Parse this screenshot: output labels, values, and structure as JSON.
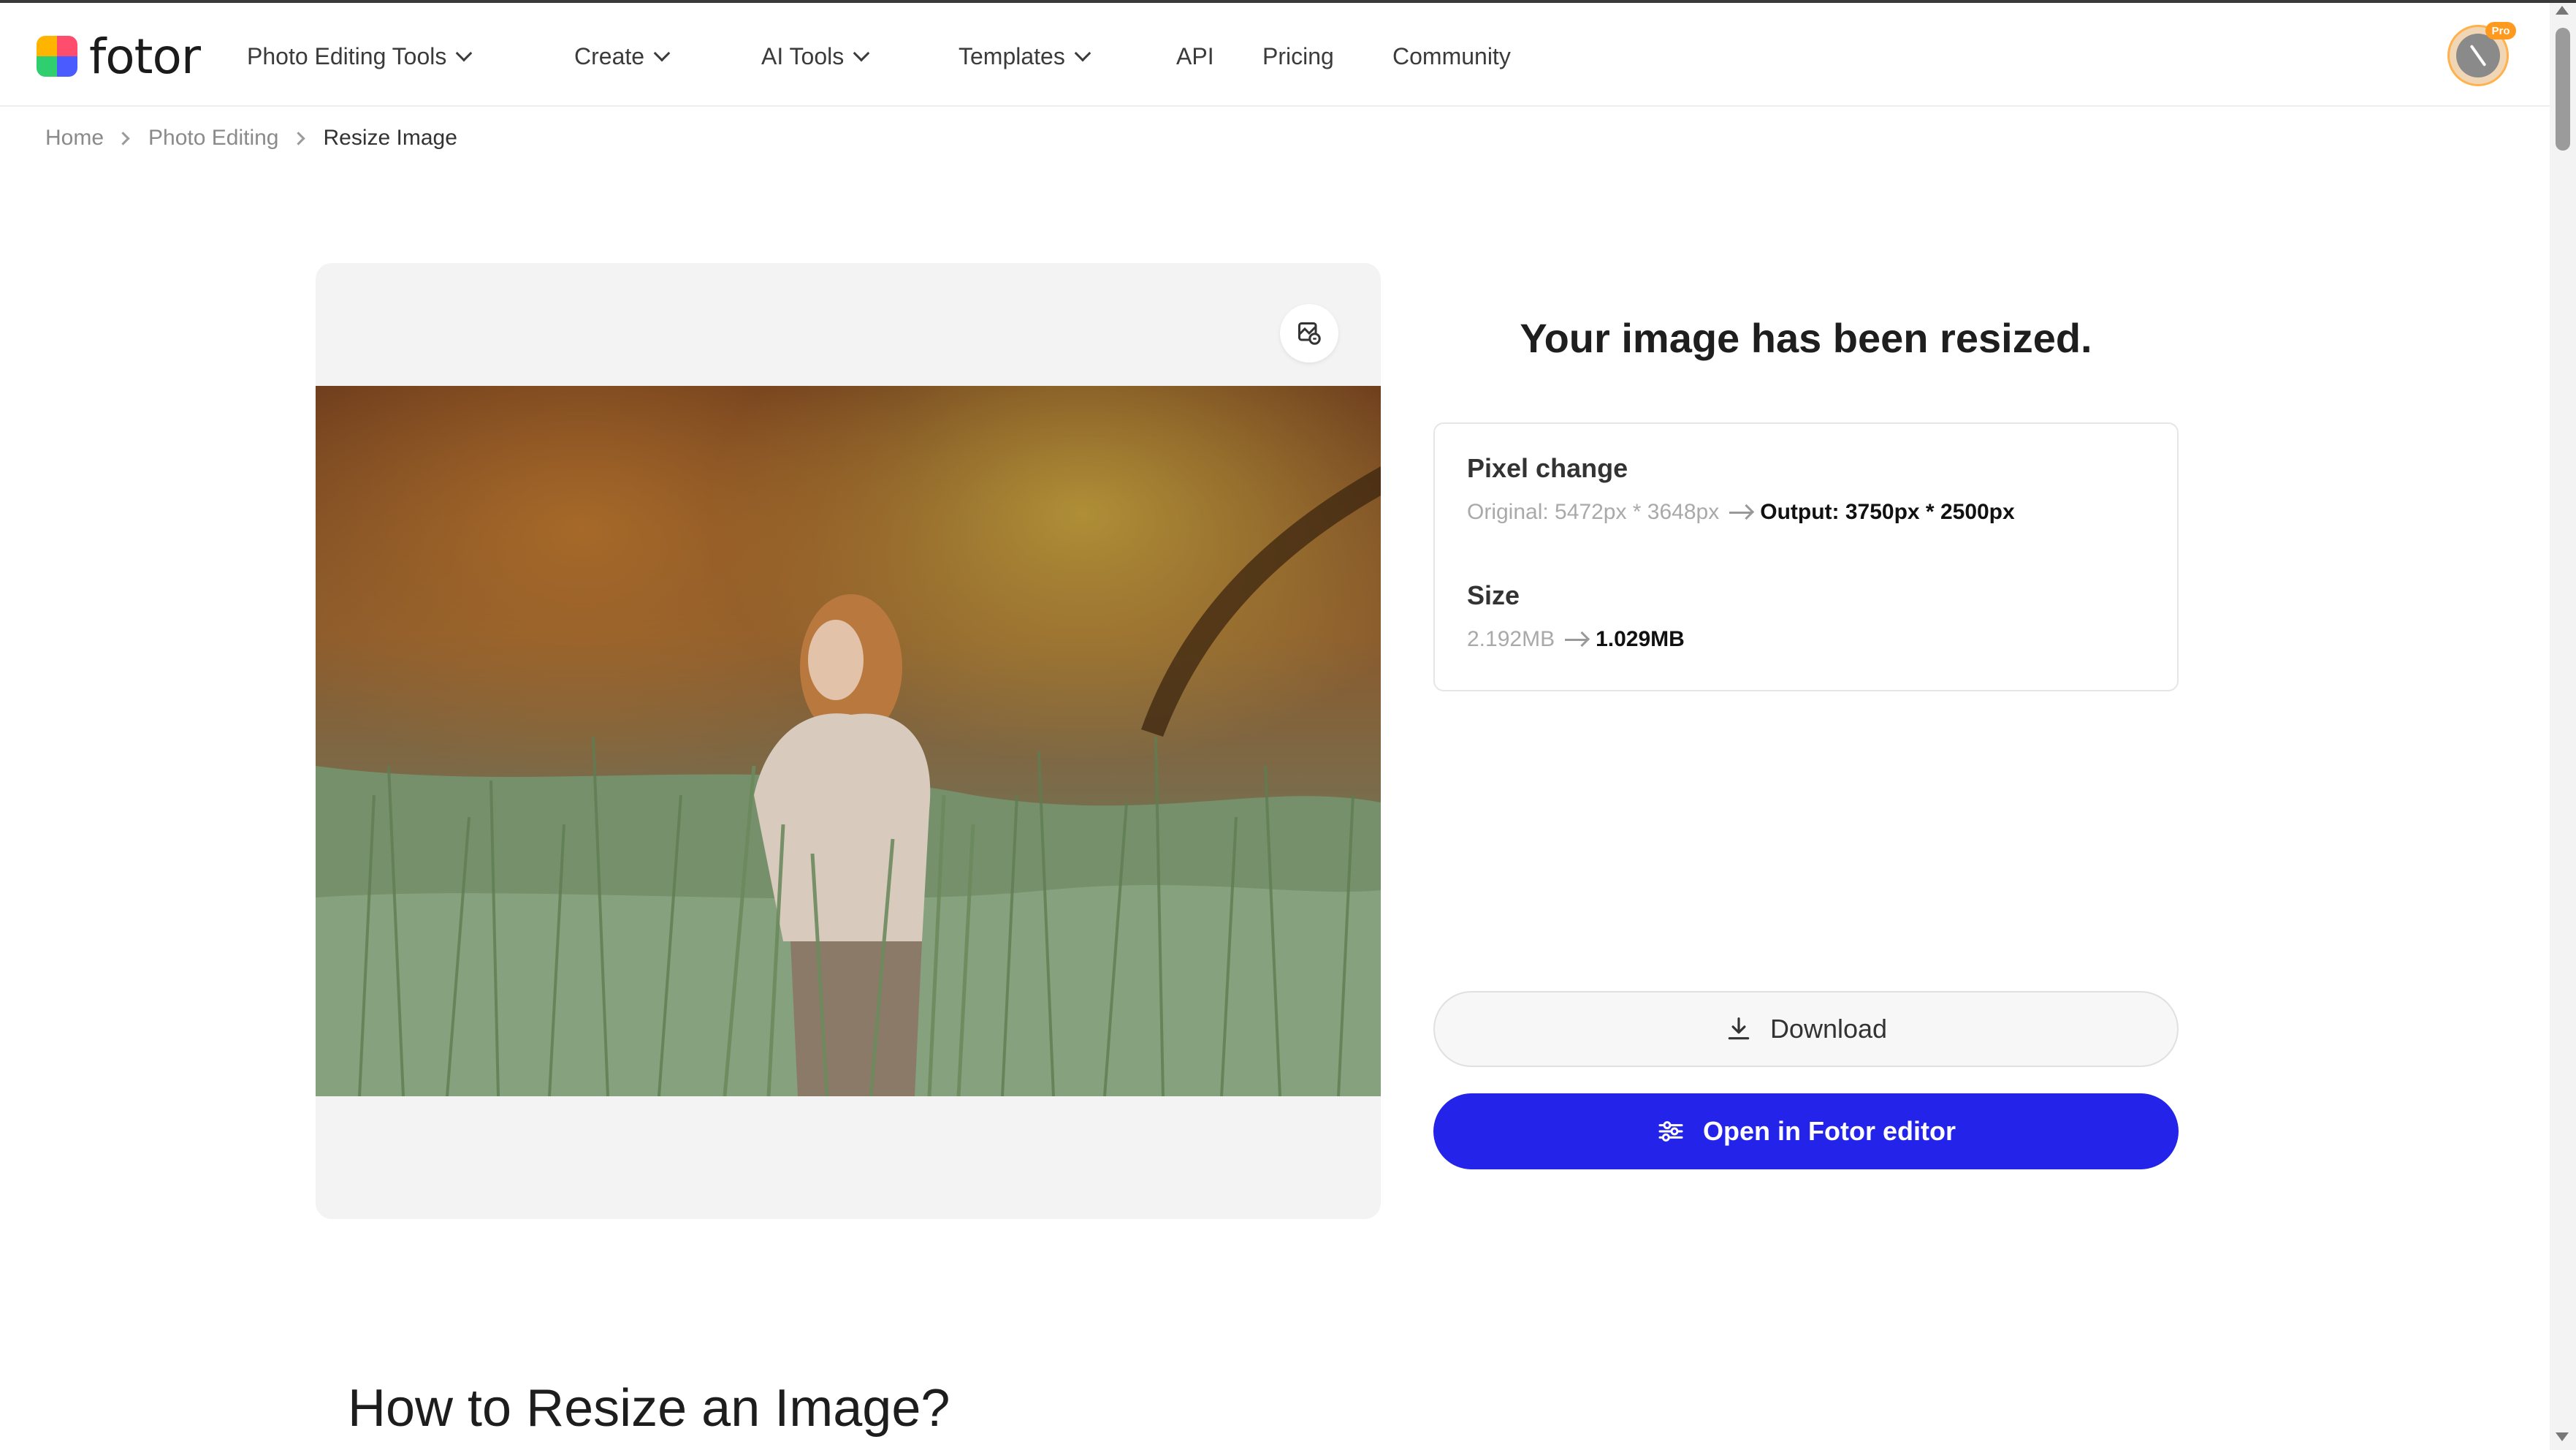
{
  "brand": {
    "logo_text": "fotor"
  },
  "nav": {
    "items": [
      {
        "label": "Photo Editing Tools",
        "has_dropdown": true
      },
      {
        "label": "Create",
        "has_dropdown": true
      },
      {
        "label": "AI Tools",
        "has_dropdown": true
      },
      {
        "label": "Templates",
        "has_dropdown": true
      },
      {
        "label": "API",
        "has_dropdown": false
      },
      {
        "label": "Pricing",
        "has_dropdown": false
      },
      {
        "label": "Community",
        "has_dropdown": false
      }
    ]
  },
  "user": {
    "badge": "Pro"
  },
  "breadcrumb": [
    "Home",
    "Photo Editing",
    "Resize Image"
  ],
  "preview": {
    "compare_icon": "compare-icon"
  },
  "result": {
    "title": "Your image has been resized.",
    "pixel_change": {
      "label": "Pixel change",
      "original": "Original: 5472px * 3648px",
      "output": "Output: 3750px * 2500px"
    },
    "size": {
      "label": "Size",
      "original": "2.192MB",
      "output": "1.029MB"
    }
  },
  "actions": {
    "download_label": "Download",
    "editor_label": "Open in Fotor editor"
  },
  "section": {
    "how_title": "How to Resize an Image?"
  },
  "colors": {
    "primary": "#2323ea",
    "badge": "#ff9a1e"
  }
}
